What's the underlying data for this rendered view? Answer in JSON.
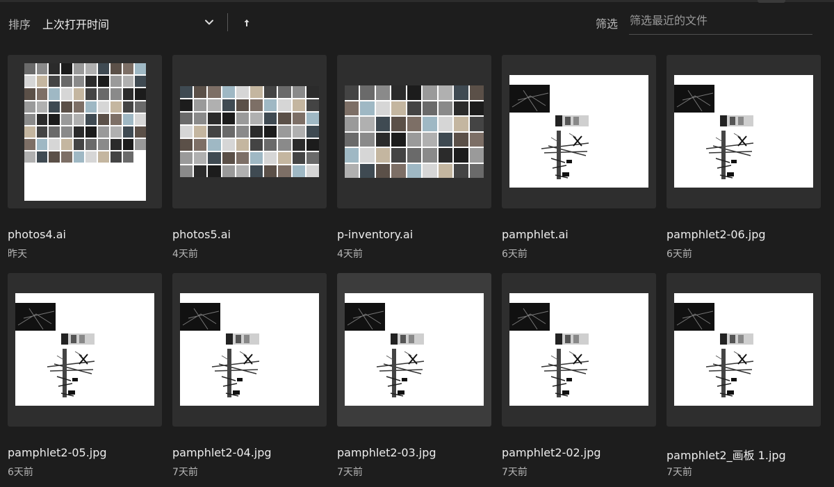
{
  "toolbar": {
    "sort_label": "排序",
    "sort_value": "上次打开时间",
    "filter_label": "筛选",
    "filter_placeholder": "筛选最近的文件"
  },
  "files": [
    {
      "name": "photos4.ai",
      "date": "昨天",
      "thumb": "photo-grid-a"
    },
    {
      "name": "photos5.ai",
      "date": "4天前",
      "thumb": "photo-grid-b"
    },
    {
      "name": "p-inventory.ai",
      "date": "4天前",
      "thumb": "photo-grid-c"
    },
    {
      "name": "pamphlet.ai",
      "date": "6天前",
      "thumb": "pamphlet"
    },
    {
      "name": "pamphlet2-06.jpg",
      "date": "6天前",
      "thumb": "pamphlet"
    },
    {
      "name": "pamphlet2-05.jpg",
      "date": "6天前",
      "thumb": "pamphlet"
    },
    {
      "name": "pamphlet2-04.jpg",
      "date": "7天前",
      "thumb": "pamphlet"
    },
    {
      "name": "pamphlet2-03.jpg",
      "date": "7天前",
      "thumb": "pamphlet",
      "selected": true
    },
    {
      "name": "pamphlet2-02.jpg",
      "date": "7天前",
      "thumb": "pamphlet"
    },
    {
      "name": "pamphlet2_画板 1.jpg",
      "date": "7天前",
      "thumb": "pamphlet"
    }
  ],
  "icons": {
    "sort_dropdown": "chevron-down-icon",
    "sort_direction": "arrow-up-icon"
  },
  "colors": {
    "background": "#1d1d1d",
    "card": "#2e2e2e",
    "card_selected": "#3c3c3c"
  }
}
